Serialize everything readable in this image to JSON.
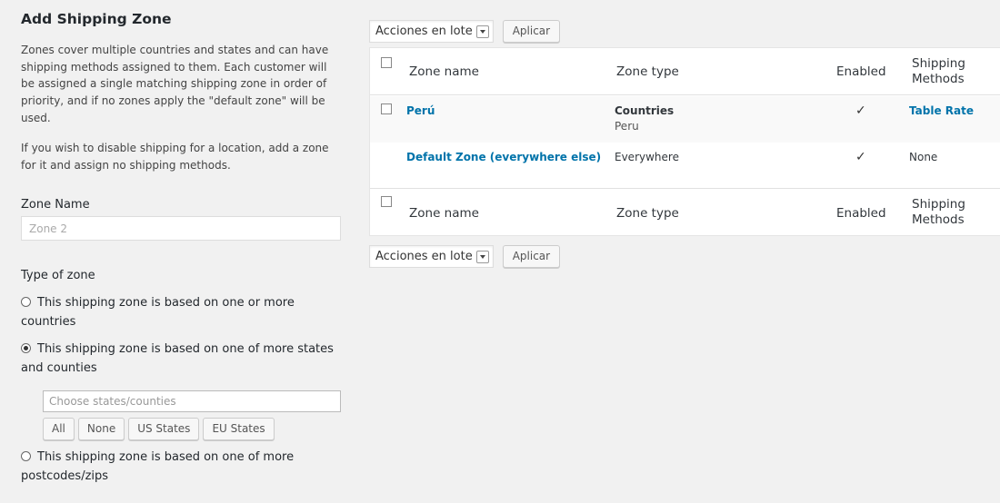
{
  "left_panel": {
    "heading": "Add Shipping Zone",
    "paragraph1": "Zones cover multiple countries and states and can have shipping methods assigned to them. Each customer will be assigned a single matching shipping zone in order of priority, and if no zones apply the \"default zone\" will be used.",
    "paragraph2": "If you wish to disable shipping for a location, add a zone for it and assign no shipping methods.",
    "zone_name_label": "Zone Name",
    "zone_name_placeholder": "Zone 2",
    "type_label": "Type of zone",
    "options": [
      {
        "label": "This shipping zone is based on one or more countries",
        "checked": false
      },
      {
        "label": "This shipping zone is based on one of more states and counties",
        "checked": true
      },
      {
        "label": "This shipping zone is based on one of more postcodes/zips",
        "checked": false
      }
    ],
    "states_placeholder": "Choose states/counties",
    "state_buttons": [
      "All",
      "None",
      "US States",
      "EU States"
    ]
  },
  "right_panel": {
    "bulk_action": "Acciones en lote",
    "apply": "Aplicar",
    "columns": {
      "zone_name": "Zone name",
      "zone_type": "Zone type",
      "enabled": "Enabled",
      "shipping_methods_1": "Shipping",
      "shipping_methods_2": "Methods"
    },
    "rows": [
      {
        "name": "Perú",
        "type": "Countries",
        "type_detail": "Peru",
        "enabled": "✓",
        "methods": "Table Rate"
      },
      {
        "name": "Default Zone (everywhere else)",
        "type": "Everywhere",
        "enabled": "✓",
        "methods": "None"
      }
    ]
  }
}
